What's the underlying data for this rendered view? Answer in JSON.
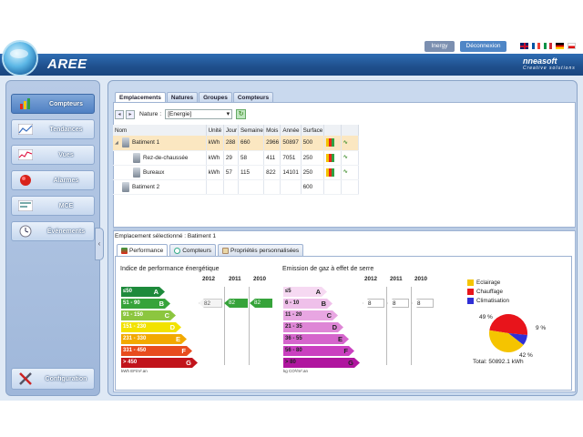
{
  "header": {
    "app_title": "AREE",
    "inergy_label": "Inergy",
    "logout_label": "Déconnexion",
    "brand": "nneasoft",
    "brand_tagline": "Creative solutions"
  },
  "sidebar": {
    "items": [
      {
        "label": "Compteurs",
        "icon": "meter-chart-icon",
        "active": true
      },
      {
        "label": "Tendances",
        "icon": "trend-icon",
        "active": false
      },
      {
        "label": "Vues",
        "icon": "views-icon",
        "active": false
      },
      {
        "label": "Alarmes",
        "icon": "alarm-icon",
        "active": false
      },
      {
        "label": "MCE",
        "icon": "mce-icon",
        "active": false
      },
      {
        "label": "Événements",
        "icon": "events-icon",
        "active": false
      }
    ],
    "config_label": "Configuration"
  },
  "tabs": [
    "Emplacements",
    "Natures",
    "Groupes",
    "Compteurs"
  ],
  "toolbar": {
    "nature_label": "Nature :",
    "nature_value": "[Energie]"
  },
  "grid": {
    "headers": [
      "Nom",
      "Unité",
      "Jour",
      "Semaine",
      "Mois",
      "Année",
      "Surface",
      "",
      ""
    ],
    "rows": [
      {
        "name": "Batiment 1",
        "unit": "kWh",
        "jour": "288",
        "semaine": "660",
        "mois": "2966",
        "annee": "50897",
        "surface": "500",
        "level": 0,
        "expander": "◢",
        "selected": true,
        "icons": true
      },
      {
        "name": "Rez-de-chaussée",
        "unit": "kWh",
        "jour": "29",
        "semaine": "58",
        "mois": "411",
        "annee": "7051",
        "surface": "250",
        "level": 1,
        "expander": "",
        "selected": false,
        "icons": true
      },
      {
        "name": "Bureaux",
        "unit": "kWh",
        "jour": "57",
        "semaine": "115",
        "mois": "822",
        "annee": "14101",
        "surface": "250",
        "level": 1,
        "expander": "",
        "selected": false,
        "icons": true
      },
      {
        "name": "Batiment 2",
        "unit": "",
        "jour": "",
        "semaine": "",
        "mois": "",
        "annee": "",
        "surface": "600",
        "level": 0,
        "expander": "",
        "selected": false,
        "icons": false
      }
    ]
  },
  "selection": {
    "label": "Emplacement sélectionné :",
    "value": "Batiment 1"
  },
  "bottom_tabs": [
    "Performance",
    "Compteurs",
    "Propriétés personnalisées"
  ],
  "perf": {
    "energy_title": "Indice de performance énergétique",
    "ges_title": "Emission de gaz à effet de serre",
    "years": [
      "2012",
      "2011",
      "2010"
    ],
    "energy_classes": [
      {
        "range": "≤50",
        "letter": "A",
        "color": "#1d8a3b"
      },
      {
        "range": "51 - 90",
        "letter": "B",
        "color": "#36a33a"
      },
      {
        "range": "91 - 150",
        "letter": "C",
        "color": "#8cc63f"
      },
      {
        "range": "151 - 230",
        "letter": "D",
        "color": "#f2e200"
      },
      {
        "range": "231 - 330",
        "letter": "E",
        "color": "#f2a900"
      },
      {
        "range": "331 - 450",
        "letter": "F",
        "color": "#e84c1e"
      },
      {
        "range": "> 450",
        "letter": "G",
        "color": "#c1141b"
      }
    ],
    "ges_classes": [
      {
        "range": "≤5",
        "letter": "A",
        "color": "#f6d9f2"
      },
      {
        "range": "6 - 10",
        "letter": "B",
        "color": "#efc0ea"
      },
      {
        "range": "11 - 20",
        "letter": "C",
        "color": "#e8a6e2"
      },
      {
        "range": "21 - 35",
        "letter": "D",
        "color": "#de86d6"
      },
      {
        "range": "36 - 55",
        "letter": "E",
        "color": "#d565cc"
      },
      {
        "range": "56 - 80",
        "letter": "F",
        "color": "#ca40c0"
      },
      {
        "range": "> 80",
        "letter": "G",
        "color": "#b0159f"
      }
    ],
    "energy_values": [
      "82",
      "82",
      "82"
    ],
    "ges_values": [
      "8",
      "8",
      "8"
    ],
    "energy_unit": "kWh EF/m².an",
    "ges_unit": "kg CO²/m².an"
  },
  "chart_data": {
    "type": "pie",
    "labels": [
      "Eclairage",
      "Chauffage",
      "Climatisation"
    ],
    "values": [
      42,
      49,
      9
    ],
    "value_labels": [
      "42 %",
      "49 %",
      "9 %"
    ],
    "colors": [
      "#f5c400",
      "#e8141b",
      "#2f2fd6"
    ],
    "total_label": "Total: 50892.1 kWh",
    "legend_position": "top"
  }
}
